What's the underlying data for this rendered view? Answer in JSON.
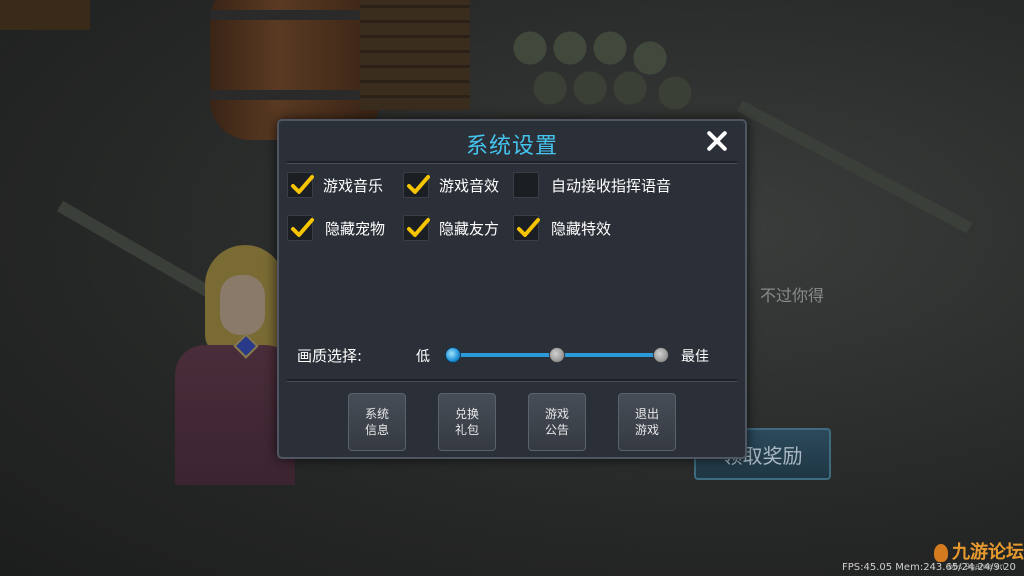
{
  "background": {
    "faded_text": "不过你得",
    "reward_button_label": "领取奖励",
    "hud_stats": "FPS:45.05  Mem:243.65/24.24/9.20",
    "watermark": "九游论坛",
    "watermark_sub": "bbs.9game.cn"
  },
  "dialog": {
    "title": "系统设置",
    "options": [
      {
        "label": "游戏音乐",
        "checked": true
      },
      {
        "label": "游戏音效",
        "checked": true
      },
      {
        "label": "自动接收指挥语音",
        "checked": false
      },
      {
        "label": "隐藏宠物",
        "checked": true
      },
      {
        "label": "隐藏友方",
        "checked": true
      },
      {
        "label": "隐藏特效",
        "checked": true
      }
    ],
    "quality": {
      "label": "画质选择:",
      "low_label": "低",
      "high_label": "最佳",
      "levels": 3,
      "selected_level": 0
    },
    "buttons": [
      {
        "label": "系统\n信息"
      },
      {
        "label": "兑换\n礼包"
      },
      {
        "label": "游戏\n公告"
      },
      {
        "label": "退出\n游戏"
      }
    ]
  },
  "colors": {
    "title": "#44c4ee",
    "checkmark": "#f6c400",
    "slider": "#2a9ad8"
  },
  "icons": {
    "close": "close-icon",
    "check": "checkmark-icon"
  }
}
